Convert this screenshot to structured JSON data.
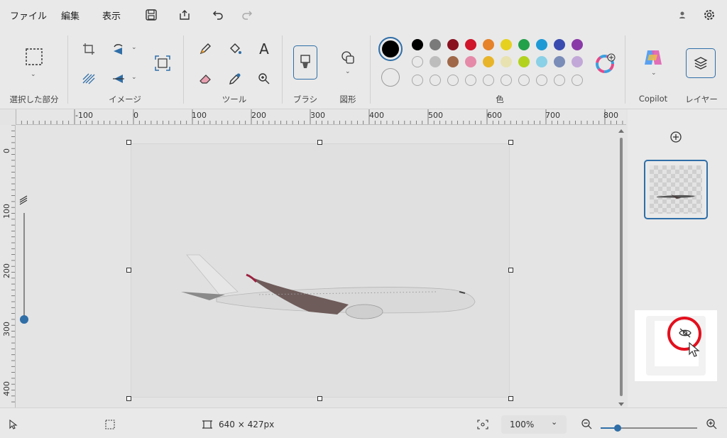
{
  "menu": {
    "file": "ファイル",
    "edit": "編集",
    "view": "表示"
  },
  "titlebar_icons": [
    "save-icon",
    "share-icon",
    "undo-icon",
    "redo-icon",
    "account-icon",
    "settings-icon"
  ],
  "ribbon": {
    "groups": {
      "selection": "選択した部分",
      "image": "イメージ",
      "tools": "ツール",
      "brush": "ブラシ",
      "shapes": "図形",
      "colors": "色",
      "copilot": "Copilot",
      "layers": "レイヤー"
    },
    "tool_text_glyph": "A",
    "primary_color": "#000000",
    "secondary_color": "#ffffff",
    "palette_row1": [
      "#000000",
      "#7a7a7a",
      "#8a1020",
      "#d0152a",
      "#e5822a",
      "#e6d11f",
      "#23a04a",
      "#1d9ad6",
      "#3a4bb0",
      "#8a3aa8"
    ],
    "palette_row2": [
      "none",
      "#bdbdbd",
      "#a06848",
      "#e58aa8",
      "#e8b52a",
      "#e8e2b0",
      "#b2d21e",
      "#8ad0e6",
      "#7a8cb8",
      "#c2a8d8"
    ]
  },
  "ruler": {
    "top": [
      "-100",
      "0",
      "100",
      "200",
      "300",
      "400",
      "500",
      "600",
      "700",
      "800"
    ],
    "left": [
      "0",
      "100",
      "200",
      "300",
      "400"
    ]
  },
  "status": {
    "image_size": "640 × 427px",
    "zoom": "100%"
  },
  "colors": {
    "accent": "#2f6ea7",
    "highlight": "#e3101e"
  }
}
